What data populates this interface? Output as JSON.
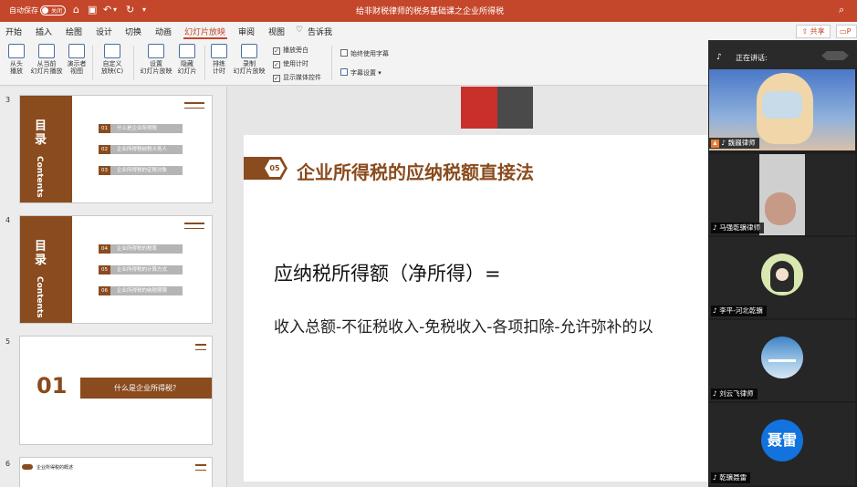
{
  "titlebar": {
    "autosave_label": "自动保存",
    "autosave_state": "关闭",
    "doc_title": "给非财税律师的税务基础课之企业所得税"
  },
  "menu": {
    "tabs": [
      {
        "label": "开始"
      },
      {
        "label": "插入"
      },
      {
        "label": "绘图"
      },
      {
        "label": "设计"
      },
      {
        "label": "切换"
      },
      {
        "label": "动画"
      },
      {
        "label": "幻灯片放映"
      },
      {
        "label": "审阅"
      },
      {
        "label": "视图"
      }
    ],
    "active_tab": "幻灯片放映",
    "tell_me": "告诉我",
    "share_label": "共享",
    "comment_label": "P"
  },
  "ribbon": {
    "from_start": {
      "line1": "从头",
      "line2": "播放"
    },
    "from_current": {
      "line1": "从当前",
      "line2": "幻灯片播放"
    },
    "presenter_view": {
      "line1": "演示者",
      "line2": "视图"
    },
    "custom_show": {
      "line1": "自定义",
      "line2": "放映(C)"
    },
    "setup_show": {
      "line1": "设置",
      "line2": "幻灯片放映"
    },
    "hide_slide": {
      "line1": "隐藏",
      "line2": "幻灯片"
    },
    "rehearse": {
      "line1": "排练",
      "line2": "计时"
    },
    "record": {
      "line1": "录制",
      "line2": "幻灯片放映"
    },
    "play_narration": "播放旁白",
    "use_timings": "使用计时",
    "show_media_controls": "显示媒体控件",
    "always_subtitles": "始终使用字幕",
    "subtitle_settings": "字幕设置"
  },
  "thumbnails": [
    {
      "num": "3",
      "title_cn": "目录",
      "title_en": "Contents",
      "items": [
        {
          "n": "01",
          "text": "什么是企业所得税"
        },
        {
          "n": "02",
          "text": "企业所得税纳税义务人"
        },
        {
          "n": "03",
          "text": "企业所得税的征税对象"
        }
      ]
    },
    {
      "num": "4",
      "title_cn": "目录",
      "title_en": "Contents",
      "items": [
        {
          "n": "04",
          "text": "企业所得税的税率"
        },
        {
          "n": "05",
          "text": "企业所得税的计算方式"
        },
        {
          "n": "06",
          "text": "企业所得税的纳税期限"
        }
      ]
    },
    {
      "num": "5",
      "big_num": "01",
      "bar_text": "什么是企业所得税？"
    },
    {
      "num": "6",
      "header_text": "企业所得税的概述"
    }
  ],
  "slide": {
    "badge": "05",
    "title": "企业所得税的应纳税额直接法",
    "line1": "应纳税所得额（净所得）=",
    "line2": "收入总额-不征税收入-免税收入-各项扣除-允许弥补的以"
  },
  "meeting": {
    "speaking_label": "正在讲话:",
    "participants": [
      {
        "name": "魏巍律师"
      },
      {
        "name": "马强乾骥律师"
      },
      {
        "name": "李平-河北乾骥"
      },
      {
        "name": "刘云飞律师"
      },
      {
        "name": "乾骥聂雷",
        "avatar_text": "聂雷"
      }
    ]
  },
  "colors": {
    "accent": "#c5472b",
    "brand_brown": "#8a4b1e",
    "avatar_blue": "#1273de"
  }
}
